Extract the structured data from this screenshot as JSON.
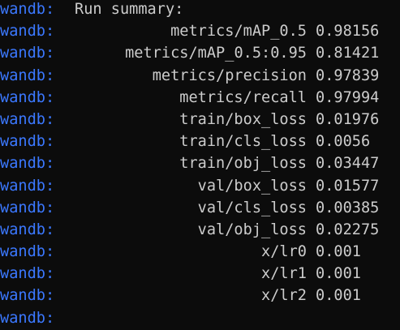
{
  "prefix": "wandb:",
  "header": "Run summary:",
  "rows": [
    {
      "key": "metrics/mAP_0.5",
      "value": "0.98156"
    },
    {
      "key": "metrics/mAP_0.5:0.95",
      "value": "0.81421"
    },
    {
      "key": "metrics/precision",
      "value": "0.97839"
    },
    {
      "key": "metrics/recall",
      "value": "0.97994"
    },
    {
      "key": "train/box_loss",
      "value": "0.01976"
    },
    {
      "key": "train/cls_loss",
      "value": "0.0056"
    },
    {
      "key": "train/obj_loss",
      "value": "0.03447"
    },
    {
      "key": "val/box_loss",
      "value": "0.01577"
    },
    {
      "key": "val/cls_loss",
      "value": "0.00385"
    },
    {
      "key": "val/obj_loss",
      "value": "0.02275"
    },
    {
      "key": "x/lr0",
      "value": "0.001"
    },
    {
      "key": "x/lr1",
      "value": "0.001"
    },
    {
      "key": "x/lr2",
      "value": "0.001"
    }
  ],
  "colors": {
    "background": "#0c0c0c",
    "prefix": "#3b78ff",
    "text": "#cccccc"
  }
}
